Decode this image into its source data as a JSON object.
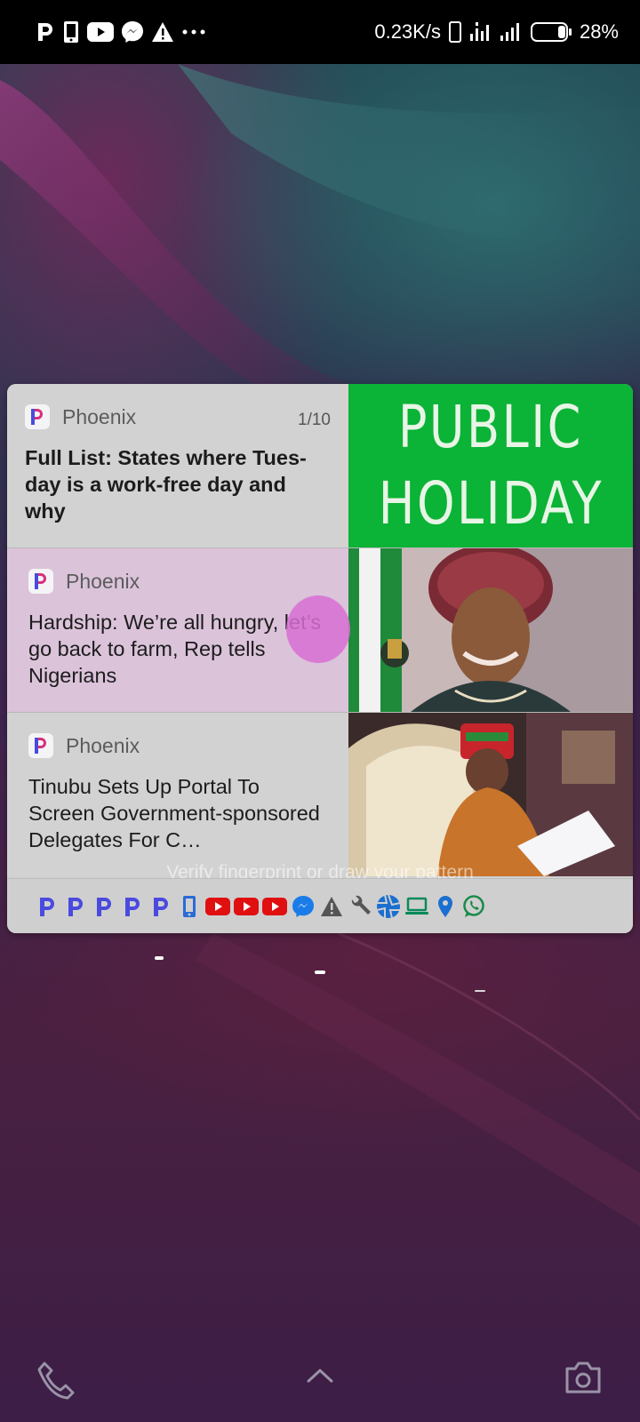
{
  "status_bar": {
    "left_icons": [
      "phoenix-p-icon",
      "phone-device-icon",
      "youtube-icon",
      "messenger-icon",
      "warning-icon",
      "more-dots-icon"
    ],
    "network_speed": "0.23K/s",
    "battery_percent": "28%"
  },
  "notifications": [
    {
      "app": "Phoenix",
      "counter": "1/10",
      "headline": "Full List: States where Tues-day is a work-free day and why",
      "image": {
        "type": "text-banner",
        "lines": [
          "PUBLIC",
          "HOLIDAY"
        ],
        "background": "#0bb336"
      }
    },
    {
      "app": "Phoenix",
      "headline": "Hardship: We’re all hungry, let’s go back to farm, Rep tells Nigerians",
      "image": {
        "type": "photo",
        "description_icon": "woman-portrait-image"
      }
    },
    {
      "app": "Phoenix",
      "headline": "Tinubu Sets Up Portal To Screen Government-sponsored Delegates For C…",
      "image": {
        "type": "photo",
        "description_icon": "man-reading-image"
      }
    }
  ],
  "lock_hint": "Verify fingerprint or draw your pattern",
  "tray_icons": [
    {
      "name": "phoenix-icon",
      "color": "#4a4adf"
    },
    {
      "name": "phoenix-icon",
      "color": "#4a4adf"
    },
    {
      "name": "phoenix-icon",
      "color": "#4a4adf"
    },
    {
      "name": "phoenix-icon",
      "color": "#4a4adf"
    },
    {
      "name": "phoenix-icon",
      "color": "#4a4adf"
    },
    {
      "name": "phone-device-icon",
      "color": "#2a6bd6"
    },
    {
      "name": "youtube-icon",
      "color": "#e01010"
    },
    {
      "name": "youtube-icon",
      "color": "#e01010"
    },
    {
      "name": "youtube-icon",
      "color": "#e01010"
    },
    {
      "name": "messenger-icon",
      "color": "#1a7ce8"
    },
    {
      "name": "warning-icon",
      "color": "#555555"
    },
    {
      "name": "wrench-icon",
      "color": "#555555"
    },
    {
      "name": "aperture-icon",
      "color": "#1a6fd0"
    },
    {
      "name": "laptop-icon",
      "color": "#0a8a5a"
    },
    {
      "name": "location-pin-icon",
      "color": "#1a6fd0"
    },
    {
      "name": "whatsapp-icon",
      "color": "#1a8a4a"
    }
  ],
  "bottom_bar": {
    "left": "phone-icon",
    "center": "chevron-up-icon",
    "right": "camera-icon"
  }
}
